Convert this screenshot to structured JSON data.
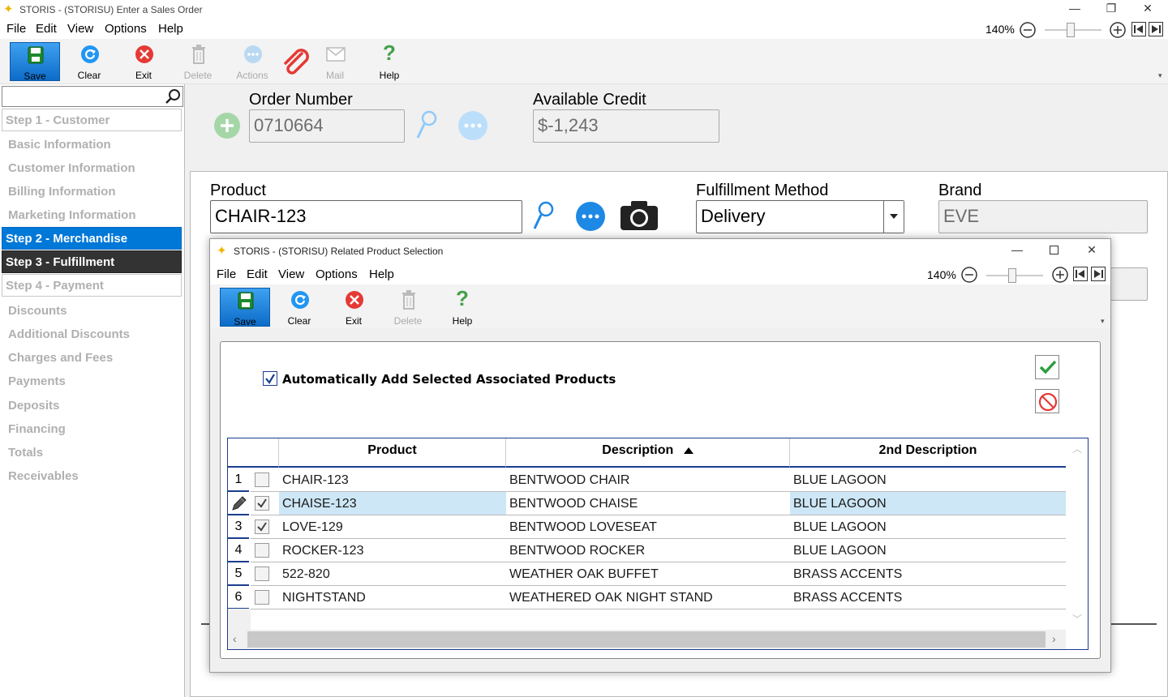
{
  "window": {
    "title": "STORIS - (STORISU) Enter a Sales Order",
    "controls": [
      "—",
      "❐",
      "✕"
    ]
  },
  "menu": [
    "File",
    "Edit",
    "View",
    "Options",
    "Help"
  ],
  "zoom": {
    "label": "140%"
  },
  "toolbar": {
    "save": "Save",
    "clear": "Clear",
    "exit": "Exit",
    "delete": "Delete",
    "actions": "Actions",
    "mail": "Mail",
    "help": "Help"
  },
  "sidebar": {
    "search_value": "",
    "step1": "Step 1 - Customer",
    "step1_items": [
      "Basic Information",
      "Customer Information",
      "Billing Information",
      "Marketing Information"
    ],
    "step2": "Step 2 - Merchandise",
    "step3": "Step 3 - Fulfillment",
    "step4": "Step 4 - Payment",
    "step4_items": [
      "Discounts",
      "Additional Discounts",
      "Charges and Fees",
      "Payments",
      "Deposits",
      "Financing",
      "Totals",
      "Receivables"
    ]
  },
  "order": {
    "order_number_label": "Order Number",
    "order_number": "0710664",
    "credit_label": "Available Credit",
    "credit": "$-1,243"
  },
  "product": {
    "product_label": "Product",
    "product_value": "CHAIR-123",
    "fulfillment_label": "Fulfillment Method",
    "fulfillment_value": "Delivery",
    "brand_label": "Brand",
    "brand_value": "EVE"
  },
  "dialog": {
    "title": "STORIS - (STORISU) Related Product Selection",
    "menu": [
      "File",
      "Edit",
      "View",
      "Options",
      "Help"
    ],
    "zoom": "140%",
    "toolbar": {
      "save": "Save",
      "clear": "Clear",
      "exit": "Exit",
      "delete": "Delete",
      "help": "Help"
    },
    "auto_add_label": "Automatically Add Selected Associated Products",
    "auto_add_checked": true,
    "grid": {
      "headers": [
        "Product",
        "Description",
        "2nd Description"
      ],
      "rows": [
        {
          "num": "1",
          "checked": false,
          "product": "CHAIR-123",
          "description": "BENTWOOD CHAIR",
          "desc2": "BLUE LAGOON"
        },
        {
          "num": "",
          "checked": true,
          "product": "CHAISE-123",
          "description": "BENTWOOD CHAISE",
          "desc2": "BLUE LAGOON"
        },
        {
          "num": "3",
          "checked": true,
          "product": "LOVE-129",
          "description": "BENTWOOD LOVESEAT",
          "desc2": "BLUE LAGOON"
        },
        {
          "num": "4",
          "checked": false,
          "product": "ROCKER-123",
          "description": "BENTWOOD ROCKER",
          "desc2": "BLUE LAGOON"
        },
        {
          "num": "5",
          "checked": false,
          "product": "522-820",
          "description": "WEATHER OAK BUFFET",
          "desc2": "BRASS ACCENTS"
        },
        {
          "num": "6",
          "checked": false,
          "product": "NIGHTSTAND",
          "description": "WEATHERED OAK NIGHT STAND",
          "desc2": "BRASS ACCENTS"
        }
      ]
    }
  },
  "colors": {
    "accent": "#0078d7",
    "active_dark": "#333333",
    "grid_border": "#1a3d8f",
    "selected_row": "#cde7f6"
  }
}
